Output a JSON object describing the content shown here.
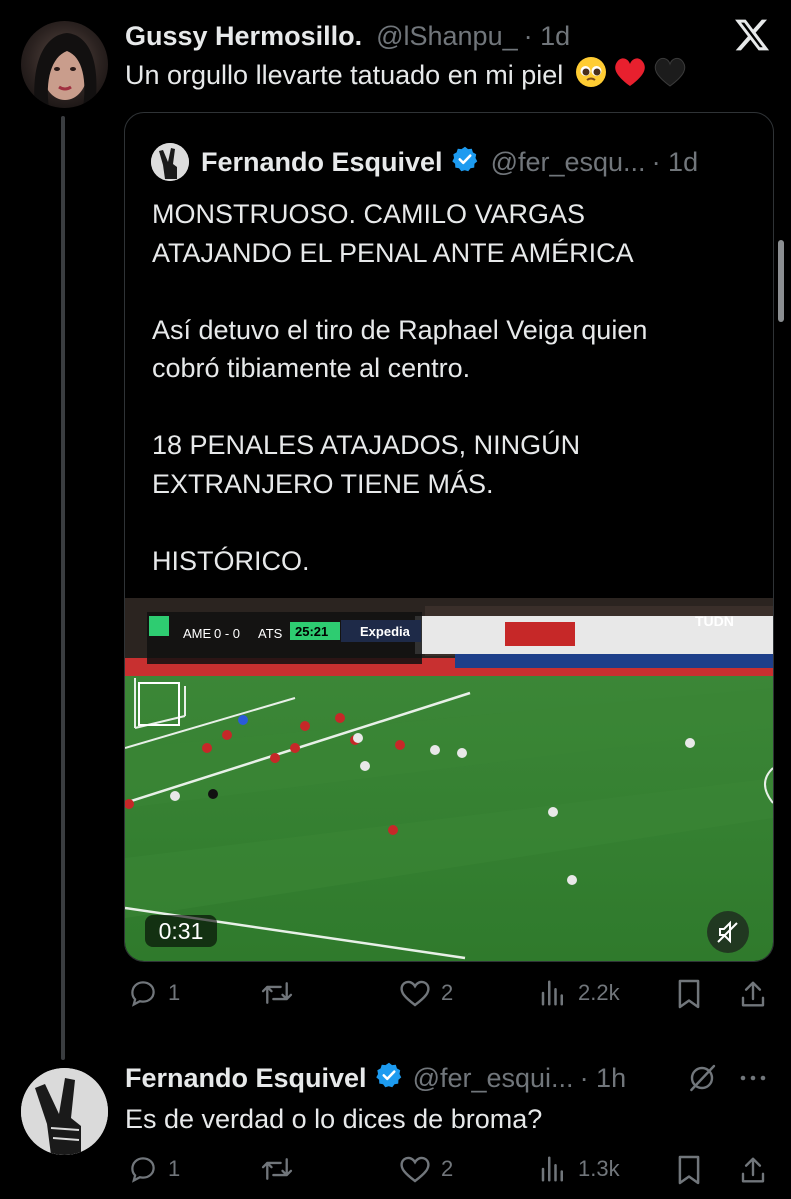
{
  "app": {
    "logo": "x-logo-icon"
  },
  "tweet": {
    "author_name": "Gussy Hermosillo.",
    "handle": "@lShanpu_",
    "time": "· 1d",
    "text": "Un orgullo llevarte tatuado en mi piel",
    "emojis": [
      "pleading-face",
      "red-heart",
      "black-heart"
    ],
    "stats": {
      "replies": "1",
      "retweets": "",
      "likes": "2",
      "views": "2.2k"
    }
  },
  "quote": {
    "author_name": "Fernando Esquivel",
    "handle": "@fer_esqu...",
    "time": "· 1d",
    "verified": true,
    "text": "MONSTRUOSO. CAMILO VARGAS\nATAJANDO EL PENAL ANTE AMÉRICA\n\nAsí detuvo el tiro de Raphael Veiga quien\ncobró tibiamente al centro.\n\n18 PENALES ATAJADOS, NINGÚN\nEXTRANJERO TIENE MÁS.\n\nHISTÓRICO.",
    "video": {
      "duration": "0:31",
      "muted": true,
      "scoreboard": {
        "home": "AME",
        "score": "0 - 0",
        "away": "ATS",
        "clock": "25:21",
        "sponsor": "Expedia",
        "broadcaster": "TUDN"
      }
    }
  },
  "reply": {
    "author_name": "Fernando Esquivel",
    "handle": "@fer_esqui...",
    "time": "· 1h",
    "verified": true,
    "text": "Es de verdad o lo dices de broma?",
    "stats": {
      "replies": "1",
      "retweets": "",
      "likes": "2",
      "views": "1.3k"
    }
  },
  "colors": {
    "background": "#000000",
    "text": "#e7e9ea",
    "muted": "#71767b",
    "verified": "#1d9bf0",
    "heart": "#e0245e"
  }
}
